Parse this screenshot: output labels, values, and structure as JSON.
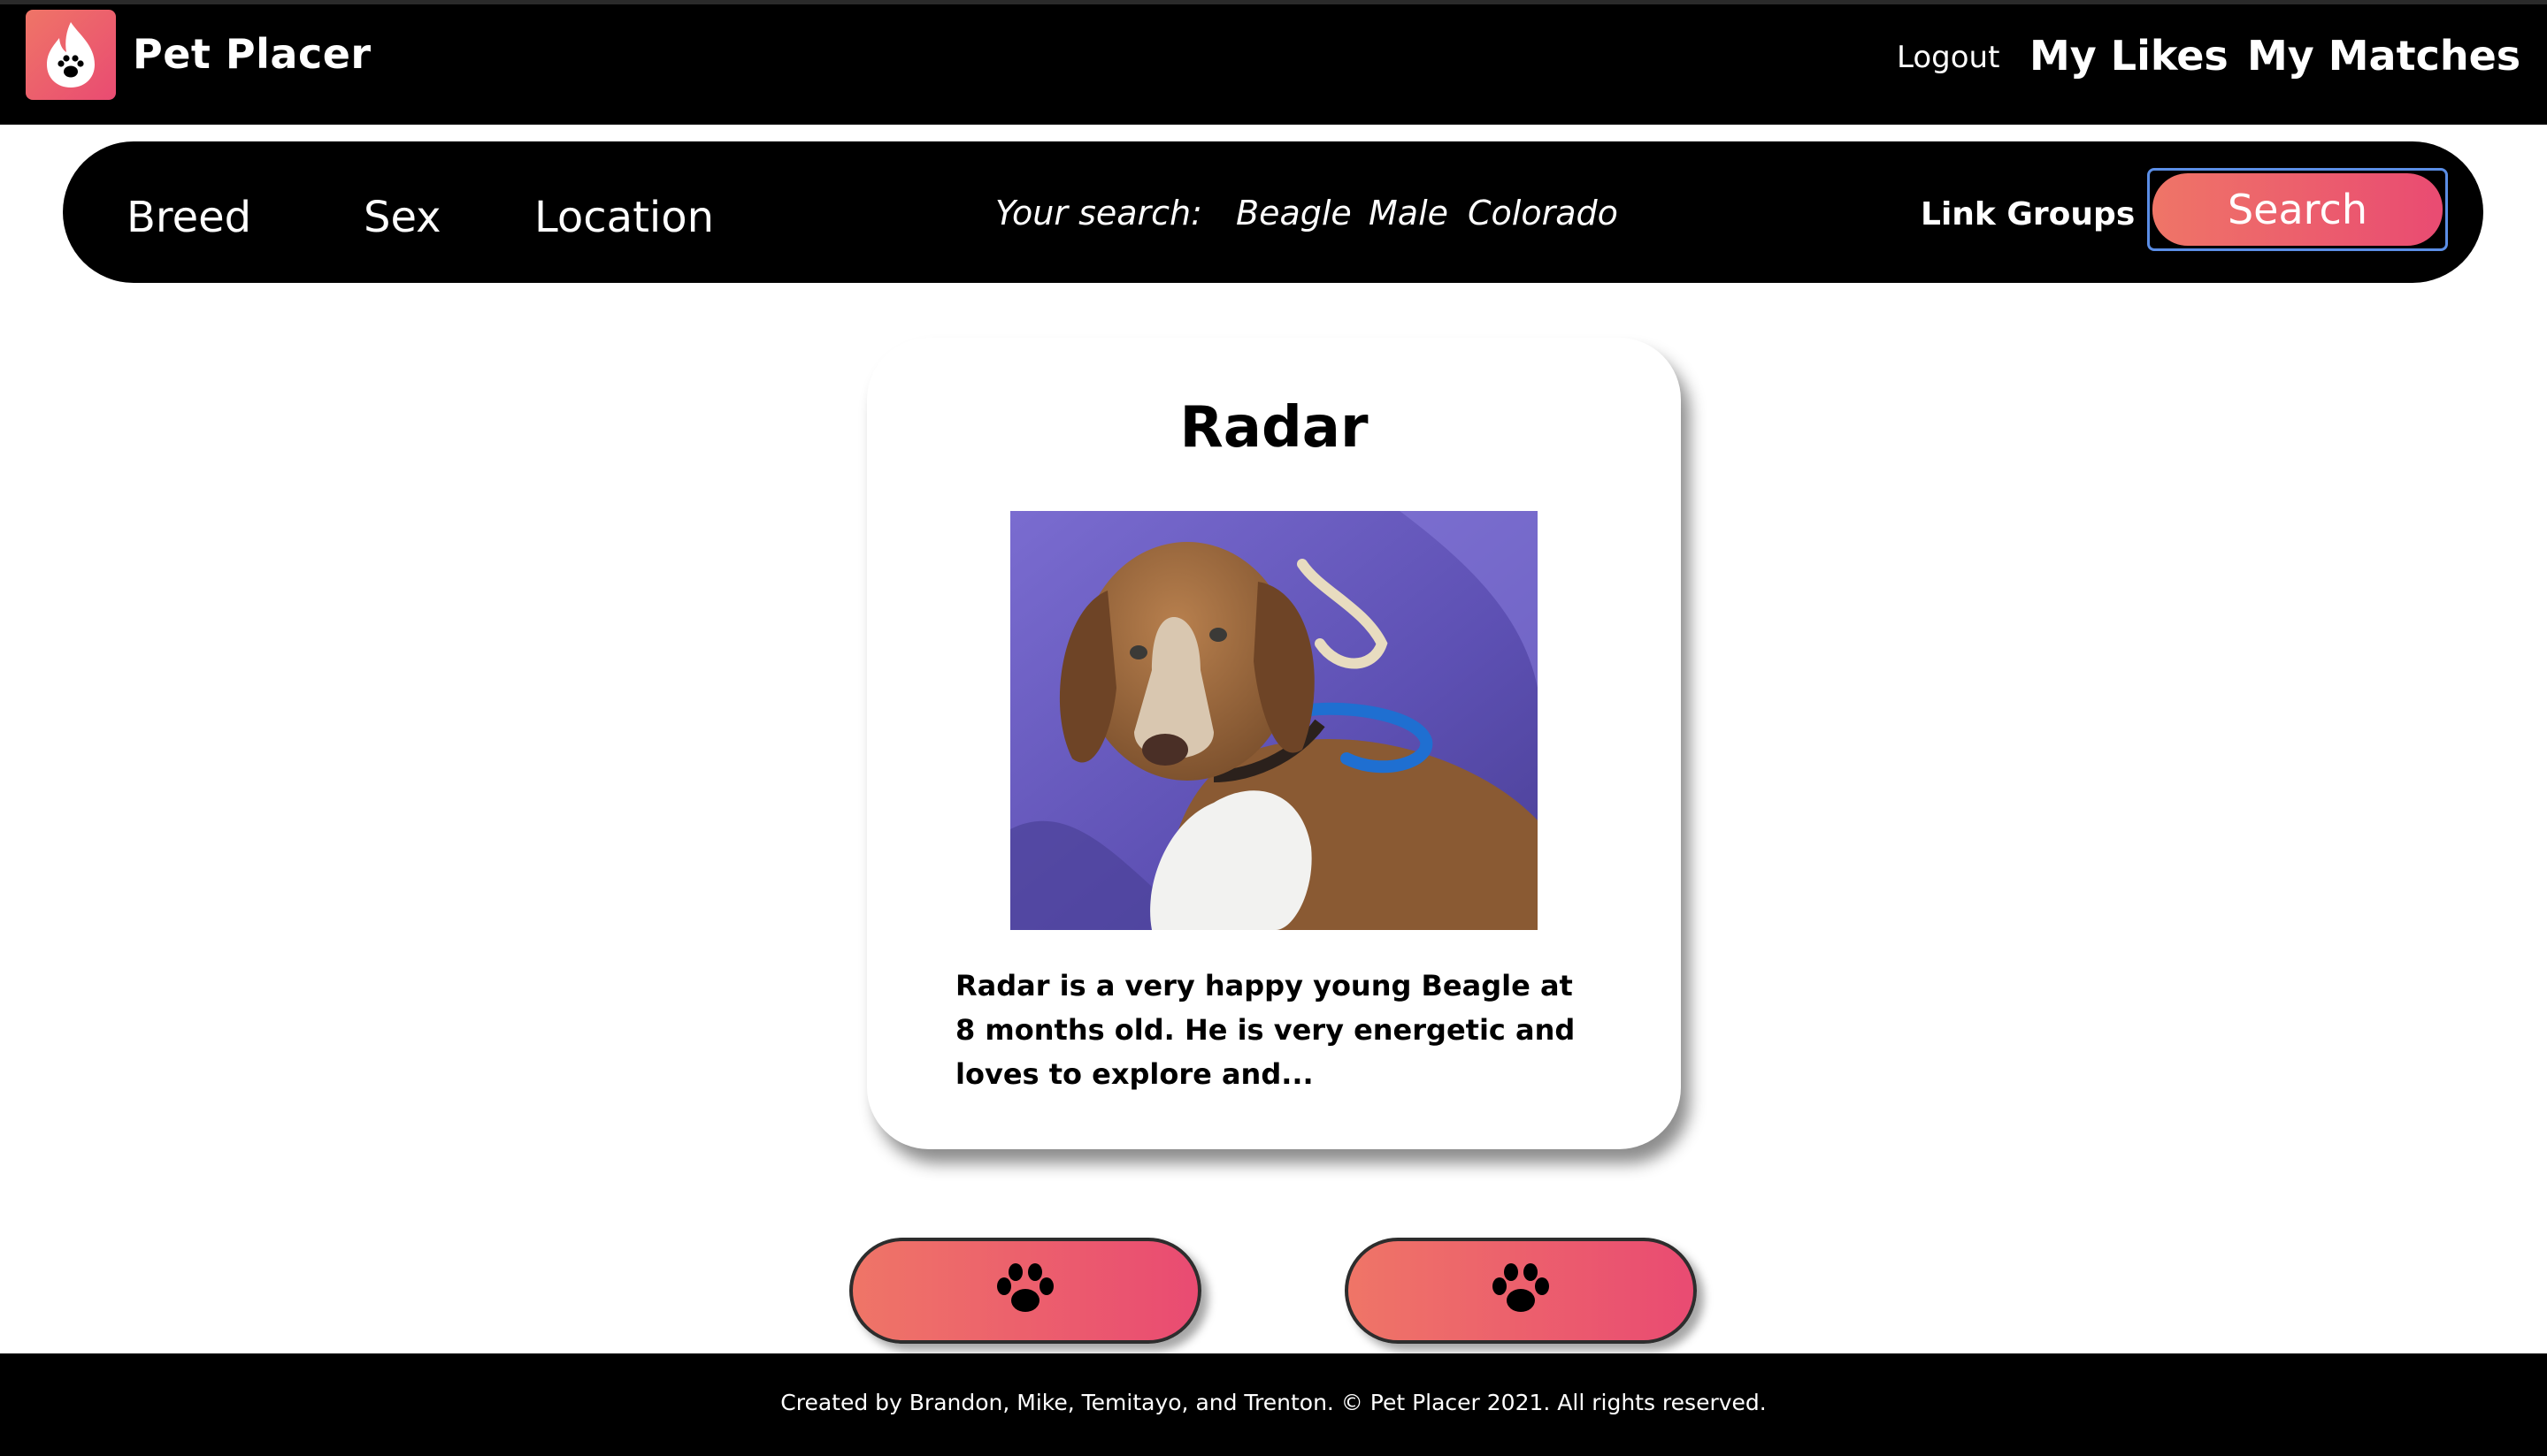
{
  "header": {
    "brand": "Pet Placer",
    "logo_icon": "paw-flame-logo-icon",
    "nav": {
      "logout": "Logout",
      "my_likes": "My Likes",
      "my_matches": "My Matches"
    }
  },
  "search_bar": {
    "filters": {
      "breed": "Breed",
      "sex": "Sex",
      "location": "Location"
    },
    "your_search_label": "Your search:",
    "current": {
      "breed": "Beagle",
      "sex": "Male",
      "location": "Colorado"
    },
    "link_groups": "Link Groups",
    "search_button": "Search"
  },
  "pet": {
    "name": "Radar",
    "photo_subject": "beagle-photo",
    "description": "Radar is a very happy young Beagle at 8 months old. He is very energetic and loves to explore and..."
  },
  "actions": {
    "left_icon": "paw-icon",
    "right_icon": "paw-icon"
  },
  "footer": {
    "text": "Created by Brandon, Mike, Temitayo, and Trenton. © Pet Placer 2021. All rights reserved."
  },
  "colors": {
    "brand_gradient_start": "#ef7567",
    "brand_gradient_end": "#e94b72",
    "header_bg": "#000000",
    "focus_outline": "#5b8ee6"
  }
}
